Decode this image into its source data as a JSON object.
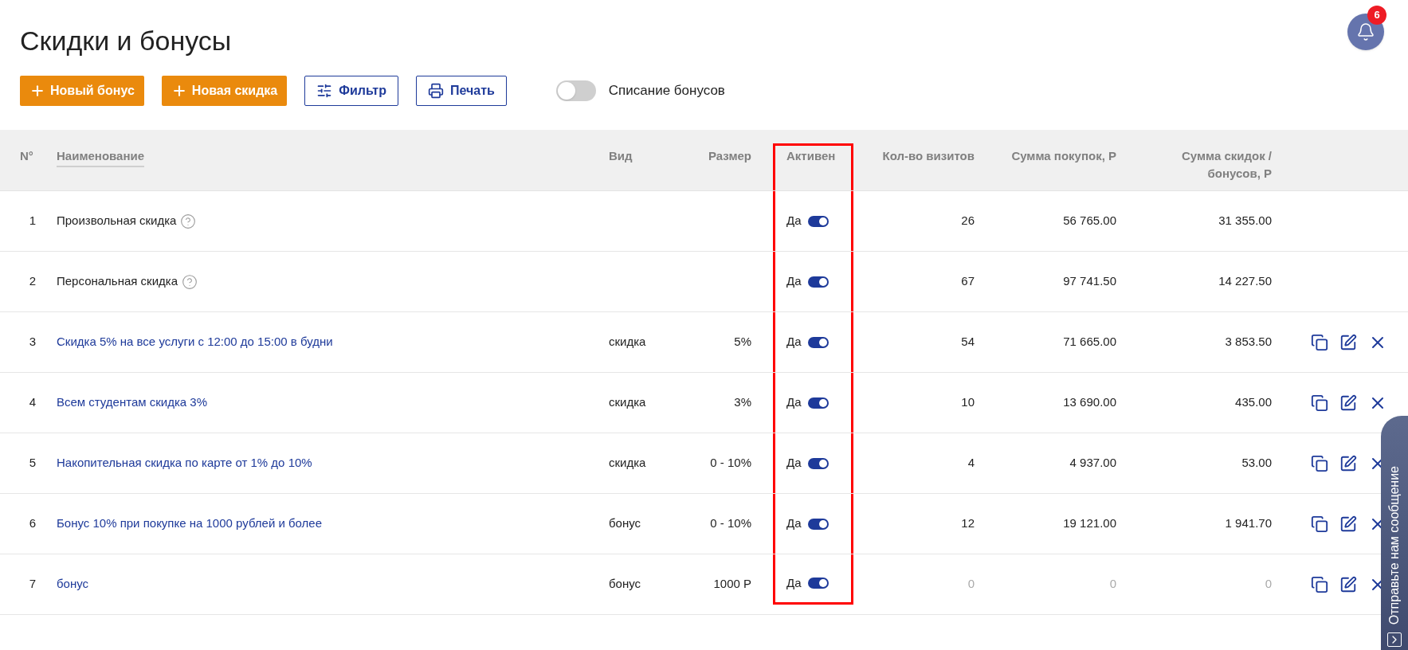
{
  "title": "Скидки и бонусы",
  "notifications": {
    "count": "6"
  },
  "toolbar": {
    "buttons": [
      {
        "kind": "primary",
        "label": "Новый бонус"
      },
      {
        "kind": "primary",
        "label": "Новая скидка"
      },
      {
        "kind": "outline",
        "label": "Фильтр"
      },
      {
        "kind": "outline",
        "label": "Печать"
      }
    ],
    "switch": {
      "label": "Списание бонусов",
      "on": false
    }
  },
  "table": {
    "columns": [
      {
        "label": "N°",
        "sortable": false,
        "highlighted": false
      },
      {
        "label": "Наименование",
        "sortable": true,
        "highlighted": false
      },
      {
        "label": "Вид",
        "sortable": false,
        "highlighted": false
      },
      {
        "label": "Размер",
        "sortable": false,
        "highlighted": false
      },
      {
        "label": "Активен",
        "sortable": false,
        "highlighted": true
      },
      {
        "label": "Кол-во визитов",
        "sortable": false,
        "highlighted": false
      },
      {
        "label": "Сумма покупок, Р",
        "sortable": false,
        "highlighted": false
      },
      {
        "label": "Сумма скидок / бонусов, Р",
        "sortable": false,
        "highlighted": false
      }
    ],
    "rows": [
      {
        "num": "1",
        "name": "Произвольная скидка",
        "link": false,
        "help": true,
        "type": "",
        "size": "",
        "active_label": "Да",
        "active": true,
        "visits": "26",
        "purchases": "56 765.00",
        "discounts": "31 355.00",
        "dimmed": false,
        "actions": false
      },
      {
        "num": "2",
        "name": "Персональная скидка",
        "link": false,
        "help": true,
        "type": "",
        "size": "",
        "active_label": "Да",
        "active": true,
        "visits": "67",
        "purchases": "97 741.50",
        "discounts": "14 227.50",
        "dimmed": false,
        "actions": false
      },
      {
        "num": "3",
        "name": "Скидка 5% на все услуги с 12:00 до 15:00 в будни",
        "link": true,
        "help": false,
        "type": "скидка",
        "size": "5%",
        "active_label": "Да",
        "active": true,
        "visits": "54",
        "purchases": "71 665.00",
        "discounts": "3 853.50",
        "dimmed": false,
        "actions": true
      },
      {
        "num": "4",
        "name": "Всем студентам скидка 3%",
        "link": true,
        "help": false,
        "type": "скидка",
        "size": "3%",
        "active_label": "Да",
        "active": true,
        "visits": "10",
        "purchases": "13 690.00",
        "discounts": "435.00",
        "dimmed": false,
        "actions": true
      },
      {
        "num": "5",
        "name": "Накопительная скидка по карте от 1% до 10%",
        "link": true,
        "help": false,
        "type": "скидка",
        "size": "0 - 10%",
        "active_label": "Да",
        "active": true,
        "visits": "4",
        "purchases": "4 937.00",
        "discounts": "53.00",
        "dimmed": false,
        "actions": true
      },
      {
        "num": "6",
        "name": "Бонус 10% при покупке на 1000 рублей и более",
        "link": true,
        "help": false,
        "type": "бонус",
        "size": "0 - 10%",
        "active_label": "Да",
        "active": true,
        "visits": "12",
        "purchases": "19 121.00",
        "discounts": "1 941.70",
        "dimmed": false,
        "actions": true
      },
      {
        "num": "7",
        "name": "бонус",
        "link": true,
        "help": false,
        "type": "бонус",
        "size": "1000 Р",
        "active_label": "Да",
        "active": true,
        "visits": "0",
        "purchases": "0",
        "discounts": "0",
        "dimmed": true,
        "actions": true
      }
    ]
  },
  "chat_tab": {
    "label": "Отправьте нам сообщение"
  }
}
